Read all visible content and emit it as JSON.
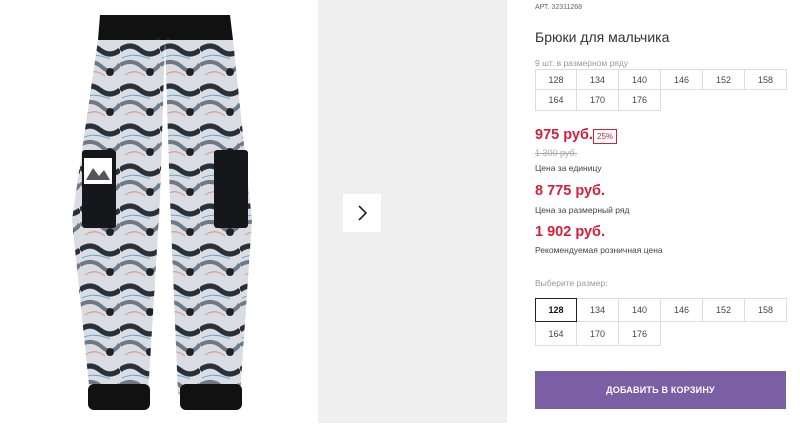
{
  "product": {
    "article_prefix": "АРТ.",
    "article_number": "32311268",
    "title": "Брюки для мальчика"
  },
  "sizes_range": {
    "label": "9 шт. в размерном ряду",
    "sizes": [
      "128",
      "134",
      "140",
      "146",
      "152",
      "158",
      "164",
      "170",
      "176"
    ]
  },
  "pricing": {
    "unit_price": "975 руб.",
    "discount_badge": "25%",
    "old_price": "1 300 руб.",
    "unit_price_label": "Цена за единицу",
    "range_price": "8 775 руб.",
    "range_price_label": "Цена за размерный ряд",
    "retail_price": "1 902 руб.",
    "retail_price_label": "Рекомендуемая розничная цена"
  },
  "size_select": {
    "label": "Выберите размер:",
    "selected": "128",
    "sizes": [
      "128",
      "134",
      "140",
      "146",
      "152",
      "158",
      "164",
      "170",
      "176"
    ]
  },
  "cart": {
    "button_label": "ДОБАВИТЬ В КОРЗИНУ"
  },
  "gallery": {
    "next_icon": "chevron-right-icon"
  },
  "colors": {
    "accent_red": "#d4203d",
    "cart_button": "#7b5fa5"
  }
}
